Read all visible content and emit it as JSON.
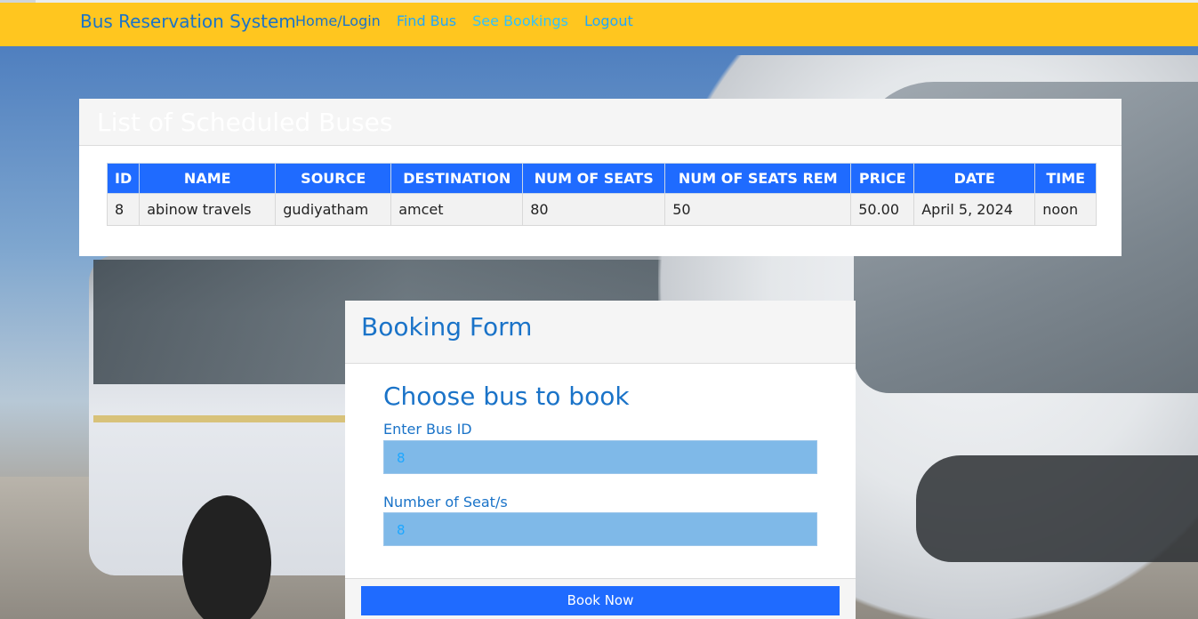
{
  "navbar": {
    "brand": "Bus Reservation System",
    "links": [
      "Home/Login",
      "Find Bus",
      "See Bookings",
      "Logout"
    ]
  },
  "buses": {
    "title": "List of Scheduled Buses",
    "columns": [
      "ID",
      "NAME",
      "SOURCE",
      "DESTINATION",
      "NUM OF SEATS",
      "NUM OF SEATS REM",
      "PRICE",
      "DATE",
      "TIME"
    ],
    "rows": [
      [
        "8",
        "abinow travels",
        "gudiyatham",
        "amcet",
        "80",
        "50",
        "50.00",
        "April 5, 2024",
        "noon"
      ]
    ]
  },
  "booking": {
    "title": "Booking Form",
    "subtitle": "Choose bus to book",
    "bus_id_label": "Enter Bus ID",
    "bus_id_value": "8",
    "seats_label": "Number of Seat/s",
    "seats_value": "8",
    "submit_label": "Book Now"
  },
  "colors": {
    "navbar": "#ffc61f",
    "primary": "#1f6bff",
    "link": "#1a73c8",
    "input_bg": "#7fb9e8"
  }
}
